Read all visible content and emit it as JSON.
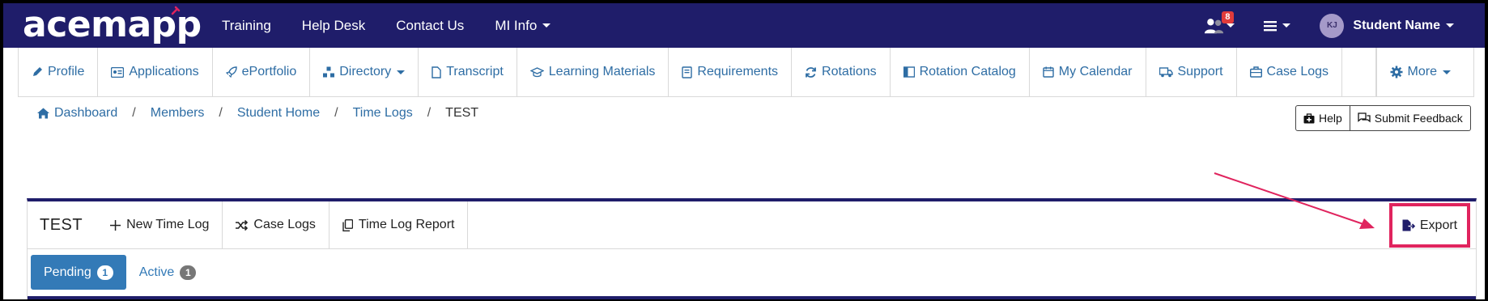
{
  "top": {
    "logo": "acemapp",
    "nav": [
      "Training",
      "Help Desk",
      "Contact Us",
      "MI Info"
    ],
    "notification_count": "8",
    "avatar_initials": "KJ",
    "user_name": "Student Name"
  },
  "subnav": {
    "items": [
      "Profile",
      "Applications",
      "ePortfolio",
      "Directory",
      "Transcript",
      "Learning Materials",
      "Requirements",
      "Rotations",
      "Rotation Catalog",
      "My Calendar",
      "Support",
      "Case Logs"
    ],
    "more": "More"
  },
  "breadcrumb": {
    "items": [
      "Dashboard",
      "Members",
      "Student Home",
      "Time Logs"
    ],
    "current": "TEST",
    "separator": "/"
  },
  "actions": {
    "help": "Help",
    "feedback": "Submit Feedback"
  },
  "panel": {
    "title": "TEST",
    "new_time_log": "New Time Log",
    "case_logs": "Case Logs",
    "time_log_report": "Time Log Report",
    "export": "Export"
  },
  "tabs": [
    {
      "label": "Pending",
      "count": "1"
    },
    {
      "label": "Active",
      "count": "1"
    }
  ],
  "colors": {
    "header_bg": "#1f1d6a",
    "link": "#2e6da4",
    "active_tab": "#337ab7",
    "highlight": "#e0245e"
  }
}
